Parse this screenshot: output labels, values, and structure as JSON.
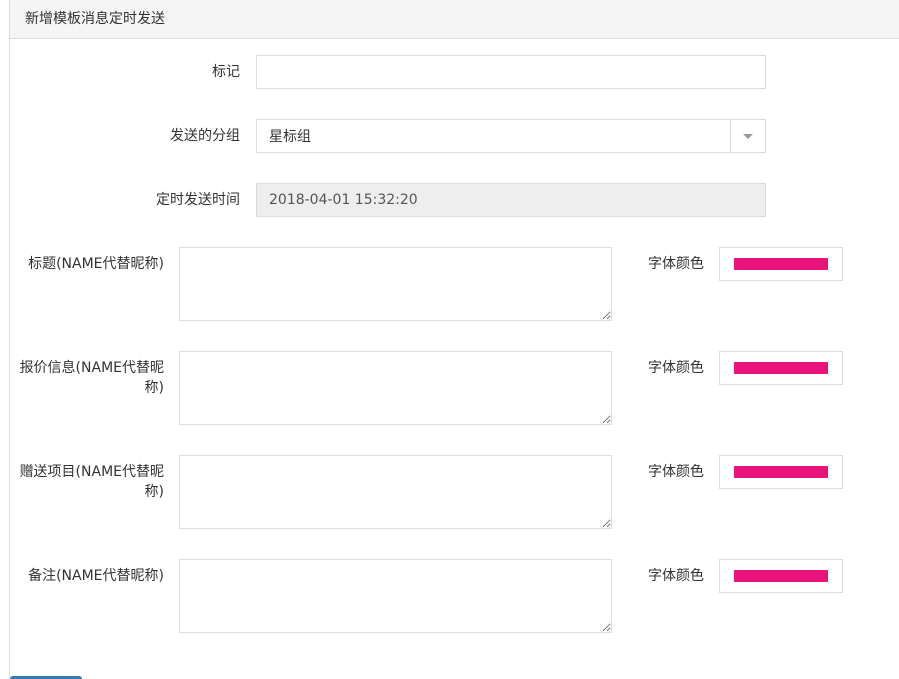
{
  "header": {
    "title": "新增模板消息定时发送"
  },
  "form": {
    "mark": {
      "label": "标记",
      "value": ""
    },
    "group": {
      "label": "发送的分组",
      "selected": "星标组"
    },
    "send_time": {
      "label": "定时发送时间",
      "value": "2018-04-01 15:32:20"
    },
    "fields": [
      {
        "label": "标题(NAME代替昵称)",
        "color_label": "字体颜色",
        "color": "#e8137c"
      },
      {
        "label_line1": "报价信息(NAME代替昵",
        "label_line2": "称)",
        "color_label": "字体颜色",
        "color": "#e8137c"
      },
      {
        "label_line1": "赠送项目(NAME代替昵",
        "label_line2": "称)",
        "color_label": "字体颜色",
        "color": "#e8137c"
      },
      {
        "label": "备注(NAME代替昵称)",
        "color_label": "字体颜色",
        "color": "#e8137c"
      }
    ]
  }
}
